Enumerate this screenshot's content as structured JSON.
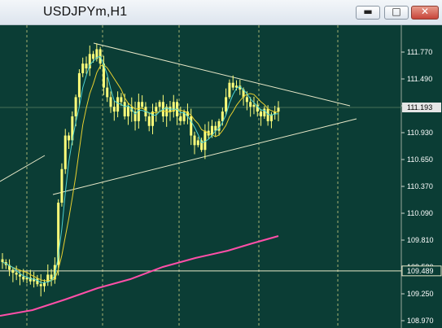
{
  "window": {
    "title": "USDJPYm,H1",
    "buttons": {
      "minimize": "▬",
      "maximize": "□",
      "close": "✕"
    }
  },
  "colors": {
    "background": "#0b3d35",
    "grid": "#d8d88a",
    "candles": "#ffff7a",
    "ma_fast": "#4fd0d0",
    "ma_slow": "#e8d030",
    "ma_long": "#ff4fa8",
    "trendlines": "#e8e8c8",
    "current_price_label_bg": "#e6e6e6",
    "axis_text": "#ffffff"
  },
  "chart_data": {
    "type": "candlestick",
    "symbol": "USDJPYm",
    "timeframe": "H1",
    "y_axis": {
      "ticks": [
        "111.770",
        "111.490",
        "111.210",
        "110.930",
        "110.650",
        "110.370",
        "110.090",
        "109.810",
        "109.530",
        "109.250",
        "108.970"
      ],
      "range": [
        108.97,
        111.99
      ]
    },
    "current_price": "111.193",
    "horizontal_line_price": "109.489",
    "grid": true,
    "candle_closes": [
      109.58,
      109.55,
      109.5,
      109.47,
      109.45,
      109.43,
      109.4,
      109.42,
      109.38,
      109.41,
      109.35,
      109.33,
      109.37,
      109.45,
      109.4,
      109.55,
      110.2,
      110.55,
      110.9,
      110.85,
      111.1,
      111.3,
      111.55,
      111.65,
      111.6,
      111.75,
      111.7,
      111.8,
      111.65,
      111.4,
      111.3,
      111.2,
      111.15,
      111.3,
      111.25,
      111.1,
      111.2,
      111.15,
      111.05,
      111.25,
      111.2,
      111.1,
      111.0,
      111.15,
      111.2,
      111.25,
      111.1,
      111.2,
      111.15,
      111.25,
      111.1,
      111.05,
      111.15,
      111.1,
      110.9,
      110.8,
      110.85,
      110.75,
      110.95,
      110.9,
      111.0,
      110.95,
      111.05,
      111.15,
      111.3,
      111.45,
      111.4,
      111.42,
      111.38,
      111.3,
      111.25,
      111.2,
      111.22,
      111.15,
      111.1,
      111.18,
      111.05,
      111.12,
      111.15,
      111.19
    ]
  }
}
